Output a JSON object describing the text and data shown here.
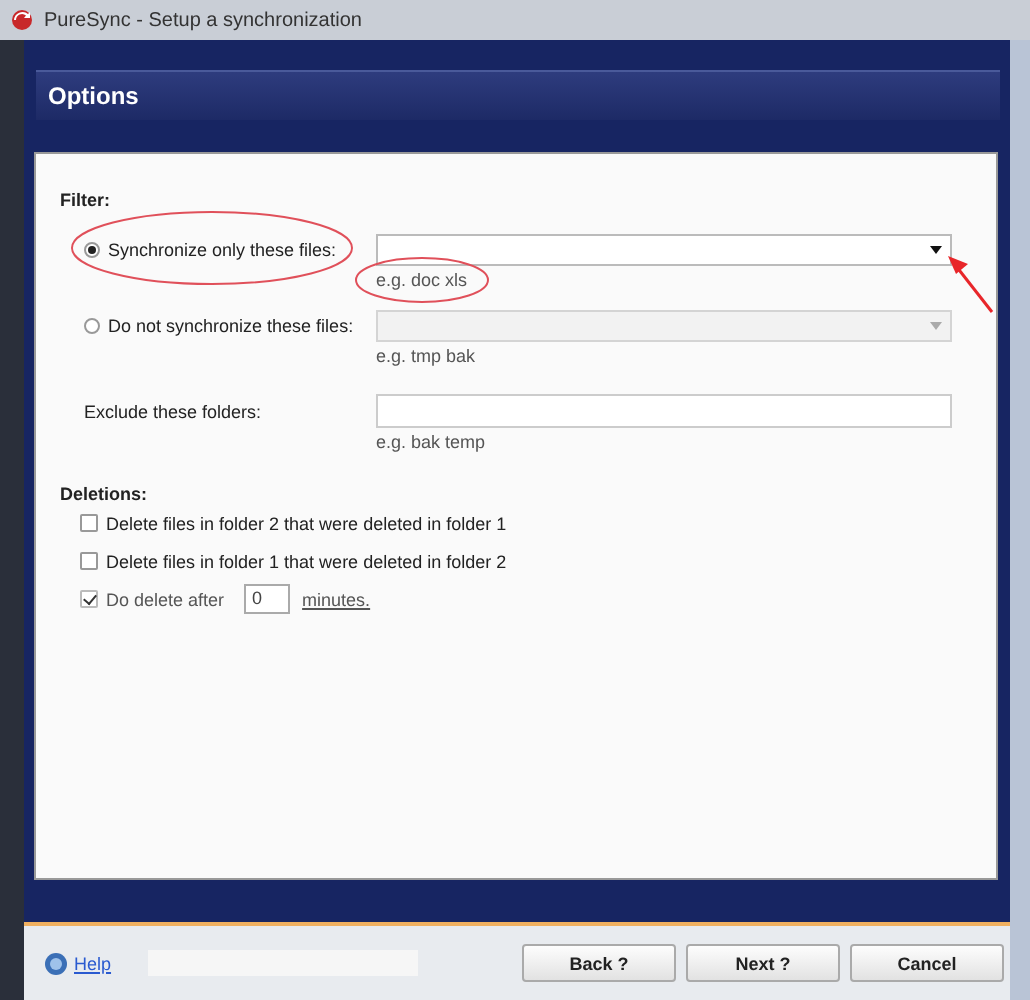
{
  "window": {
    "title": "PureSync - Setup a synchronization"
  },
  "header": {
    "title": "Options"
  },
  "filter": {
    "heading": "Filter:",
    "options": [
      {
        "label": "Synchronize only these files:",
        "selected": true,
        "hint": "e.g. doc xls",
        "disabled": false
      },
      {
        "label": "Do not synchronize these files:",
        "selected": false,
        "hint": "e.g. tmp bak",
        "disabled": true
      }
    ],
    "exclude": {
      "label": "Exclude these folders:",
      "hint": "e.g. bak temp"
    }
  },
  "deletions": {
    "heading": "Deletions:",
    "items": [
      {
        "kind": "checkbox",
        "label": "Delete files in folder 2 that were deleted in folder 1",
        "checked": false,
        "disabled": false
      },
      {
        "kind": "checkbox",
        "label": "Delete files in folder 1 that were deleted in folder 2",
        "checked": false,
        "disabled": false
      },
      {
        "kind": "delay",
        "label": "Do delete after",
        "checked": true,
        "disabled": true,
        "value": "0",
        "unit": "minutes."
      }
    ]
  },
  "footer": {
    "help": "Help",
    "buttons": [
      "Back ?",
      "Next ?",
      "Cancel"
    ]
  }
}
